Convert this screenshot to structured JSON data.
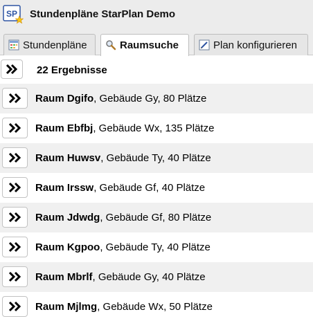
{
  "app": {
    "logo_text": "SP",
    "title": "Stundenpläne StarPlan Demo"
  },
  "tabs": [
    {
      "label": "Stundenpläne",
      "icon": "timetable-icon",
      "active": false
    },
    {
      "label": "Raumsuche",
      "icon": "magnifier-icon",
      "active": true
    },
    {
      "label": "Plan konfigurieren",
      "icon": "edit-icon",
      "active": false
    }
  ],
  "results": {
    "count_label": "22 Ergebnisse",
    "items": [
      {
        "room": "Raum Dgifo",
        "details": ", Gebäude Gy, 80 Plätze"
      },
      {
        "room": "Raum Ebfbj",
        "details": ", Gebäude Wx, 135 Plätze"
      },
      {
        "room": "Raum Huwsv",
        "details": ", Gebäude Ty, 40 Plätze"
      },
      {
        "room": "Raum Irssw",
        "details": ", Gebäude Gf, 40 Plätze"
      },
      {
        "room": "Raum Jdwdg",
        "details": ", Gebäude Gf, 80 Plätze"
      },
      {
        "room": "Raum Kgpoo",
        "details": ", Gebäude Ty, 40 Plätze"
      },
      {
        "room": "Raum Mbrlf",
        "details": ", Gebäude Gy, 40 Plätze"
      },
      {
        "room": "Raum Mjlmg",
        "details": ", Gebäude Wx, 50 Plätze"
      }
    ]
  },
  "colors": {
    "logo_blue": "#2e55a3",
    "star_yellow": "#f5c518",
    "alt_row": "#f0f0f0",
    "header_bg": "#ececec"
  }
}
